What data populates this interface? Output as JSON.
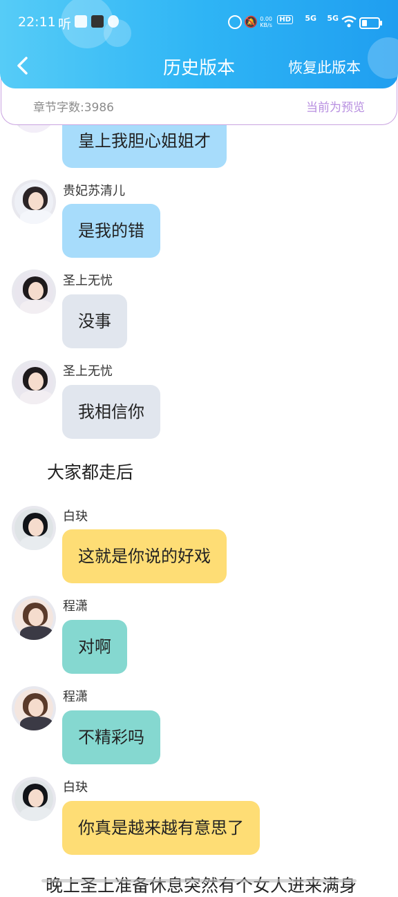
{
  "status_bar": {
    "time": "22:11",
    "ting": "听",
    "net_speed_value": "0.00",
    "net_speed_unit": "KB/s",
    "hd": "HD",
    "net1": "5G",
    "net2": "5G"
  },
  "header": {
    "title": "历史版本",
    "restore_label": "恢复此版本"
  },
  "info": {
    "word_count": "章节字数:3986",
    "preview_label": "当前为预览"
  },
  "messages": [
    {
      "type": "bubble",
      "name": "",
      "text": "皇上我胆心姐姐才"
    },
    {
      "type": "bubble",
      "name": "贵妃苏清儿",
      "text": "是我的错"
    },
    {
      "type": "bubble",
      "name": "圣上无忧",
      "text": "没事"
    },
    {
      "type": "bubble",
      "name": "圣上无忧",
      "text": "我相信你"
    },
    {
      "type": "narration",
      "text": "大家都走后"
    },
    {
      "type": "bubble",
      "name": "白玦",
      "text": "这就是你说的好戏"
    },
    {
      "type": "bubble",
      "name": "程潇",
      "text": "对啊"
    },
    {
      "type": "bubble",
      "name": "程潇",
      "text": "不精彩吗"
    },
    {
      "type": "bubble",
      "name": "白玦",
      "text": "你真是越来越有意思了"
    },
    {
      "type": "narration",
      "text": "晚上圣上准备休息突然有个女人进来满身"
    }
  ],
  "colors": {
    "header_start": "#56ccf7",
    "header_end": "#1f9ef0",
    "bubble_blue": "#a7dcfb",
    "bubble_gray": "#e1e6ee",
    "bubble_yellow": "#fedd75",
    "bubble_teal": "#85d8d0",
    "preview_purple": "#b78ee0"
  }
}
